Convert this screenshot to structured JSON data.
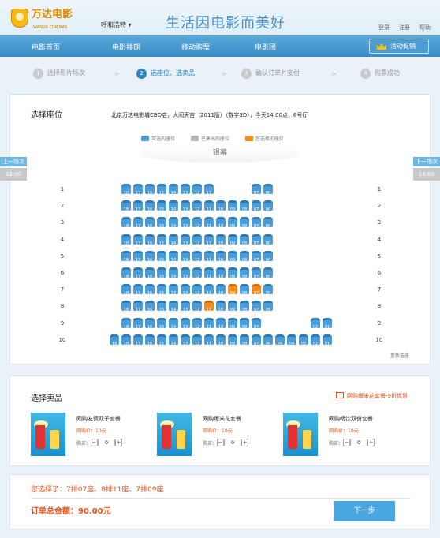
{
  "header": {
    "brand_name": "万达电影",
    "brand_en": "WANDA CINEMAS",
    "city": "呼和浩特",
    "city_caret": "▾",
    "slogan": "生活因电影而美好",
    "links": [
      "登录",
      "注册",
      "帮助"
    ]
  },
  "nav": {
    "items": [
      "电影首页",
      "电影排期",
      "移动购票",
      "电影团"
    ],
    "promo": "活动促销"
  },
  "steps": [
    {
      "num": "1",
      "label": "选择影片场次"
    },
    {
      "num": "2",
      "label": "选座位、选卖品"
    },
    {
      "num": "3",
      "label": "确认订单并支付"
    },
    {
      "num": "4",
      "label": "购票成功"
    }
  ],
  "step_arrow": ">",
  "seat_section": {
    "title": "选择座位",
    "show_info": "北京万达电影城CBD店，大闹天宫（2011版）（数字3D），今天14:00点，6号厅",
    "legend": {
      "available": "可选的座位",
      "sold": "已售出的座位",
      "selected": "您选择的座位"
    },
    "screen": "银幕",
    "prev_show": {
      "label": "上一场次",
      "time": "12:00"
    },
    "next_show": {
      "label": "下一场次",
      "time": "16:00"
    },
    "reselect": "重新选座",
    "colors": {
      "available": "#4b9dd8",
      "sold": "#b5b5b5",
      "selected": "#f28c1e"
    }
  },
  "seat_rows": [
    {
      "row": "1",
      "seats": [
        "18",
        "17",
        "16",
        "15",
        "14",
        "13",
        "12",
        "11",
        "",
        "",
        "",
        "07",
        "06"
      ],
      "lead": 0,
      "selected": []
    },
    {
      "row": "2",
      "seats": [
        "18",
        "17",
        "16",
        "15",
        "14",
        "13",
        "12",
        "11",
        "10",
        "09",
        "08",
        "07",
        "06"
      ],
      "lead": 0,
      "selected": []
    },
    {
      "row": "3",
      "seats": [
        "18",
        "17",
        "16",
        "15",
        "14",
        "13",
        "12",
        "11",
        "10",
        "09",
        "08",
        "07",
        "06"
      ],
      "lead": 0,
      "selected": []
    },
    {
      "row": "4",
      "seats": [
        "18",
        "17",
        "16",
        "15",
        "14",
        "13",
        "12",
        "11",
        "10",
        "09",
        "08",
        "07",
        "06"
      ],
      "lead": 0,
      "selected": []
    },
    {
      "row": "5",
      "seats": [
        "18",
        "17",
        "16",
        "15",
        "14",
        "13",
        "12",
        "11",
        "10",
        "09",
        "08",
        "07",
        "06"
      ],
      "lead": 0,
      "selected": []
    },
    {
      "row": "6",
      "seats": [
        "18",
        "17",
        "16",
        "15",
        "14",
        "13",
        "12",
        "11",
        "10",
        "09",
        "08",
        "07",
        "06"
      ],
      "lead": 0,
      "selected": []
    },
    {
      "row": "7",
      "seats": [
        "18",
        "17",
        "16",
        "15",
        "14",
        "13",
        "12",
        "11",
        "10",
        "09",
        "08",
        "07",
        "06"
      ],
      "lead": 0,
      "selected": [
        "09",
        "07"
      ]
    },
    {
      "row": "8",
      "seats": [
        "18",
        "17",
        "16",
        "15",
        "14",
        "13",
        "12",
        "11",
        "10",
        "09",
        "08",
        "07",
        "06"
      ],
      "lead": 0,
      "selected": [
        "11"
      ]
    },
    {
      "row": "9",
      "seats": [
        "18",
        "17",
        "16",
        "15",
        "14",
        "13",
        "12",
        "11",
        "10",
        "09",
        "08",
        "07",
        "",
        "",
        "",
        "",
        "02",
        "01"
      ],
      "lead": 0,
      "selected": []
    },
    {
      "row": "10",
      "seats": [
        "19",
        "18",
        "17",
        "16",
        "15",
        "14",
        "13",
        "12",
        "11",
        "10",
        "09",
        "08",
        "07",
        "06",
        "05",
        "04",
        "03",
        "02",
        "01"
      ],
      "lead": 1,
      "selected": []
    }
  ],
  "snack_section": {
    "title": "选择卖品",
    "offer": "网购爆米花套餐-9折优惠",
    "buy_label": "购买：",
    "minus": "−",
    "plus": "+",
    "items": [
      {
        "name": "网购友情双子套餐",
        "price": "网购价：10元",
        "qty": "0"
      },
      {
        "name": "网购爆米花套餐",
        "price": "网购价：10元",
        "qty": "0"
      },
      {
        "name": "网购畅饮双份套餐",
        "price": "网购价：10元",
        "qty": "0"
      }
    ]
  },
  "order": {
    "chosen": "您选择了：7排07座、8排11座、7排09座",
    "total": "订单总金额：90.00元",
    "next_button": "下一步"
  }
}
